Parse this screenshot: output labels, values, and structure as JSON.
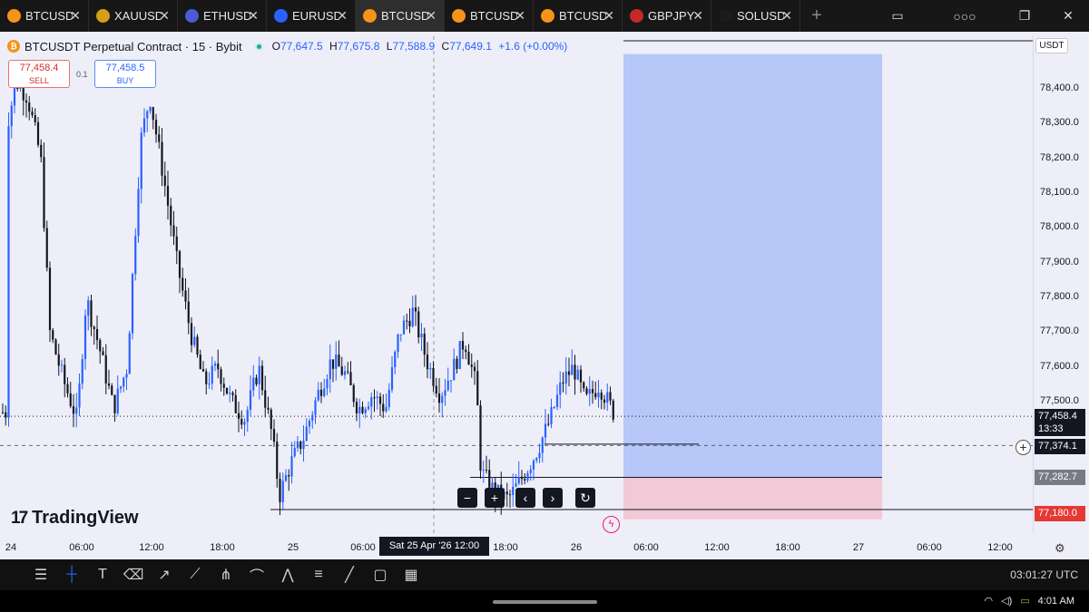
{
  "tabs": [
    {
      "label": "BTCUSD",
      "icon": "bitcoin-icon",
      "color": "#f7931a",
      "active": false
    },
    {
      "label": "XAUUSD",
      "icon": "gold-bars-icon",
      "color": "#d4a017",
      "active": false
    },
    {
      "label": "ETHUSD",
      "icon": "ethereum-icon",
      "color": "#4a5bd4",
      "active": false
    },
    {
      "label": "EURUSD",
      "icon": "euro-flag-icon",
      "color": "#2962ff",
      "active": false
    },
    {
      "label": "BTCUSD",
      "icon": "bitcoin-icon",
      "color": "#f7931a",
      "active": true
    },
    {
      "label": "BTCUSD",
      "icon": "bitcoin-icon",
      "color": "#f7931a",
      "active": false
    },
    {
      "label": "BTCUSD",
      "icon": "bitcoin-icon",
      "color": "#f7931a",
      "active": false
    },
    {
      "label": "GBPJPY",
      "icon": "uk-flag-icon",
      "color": "#c62828",
      "active": false
    },
    {
      "label": "SOLUSD",
      "icon": "solana-icon",
      "color": "#1b1b1b",
      "active": false
    }
  ],
  "header": {
    "title": "BTCUSDT Perpetual Contract · 15 · Bybit",
    "o_label": "O",
    "o_value": "77,647.5",
    "h_label": "H",
    "h_value": "77,675.8",
    "l_label": "L",
    "l_value": "77,588.9",
    "c_label": "C",
    "c_value": "77,649.1",
    "change": "+1.6 (+0.00%)"
  },
  "trade": {
    "sell_price": "77,458.4",
    "sell_label": "SELL",
    "spread": "0.1",
    "buy_price": "77,458.5",
    "buy_label": "BUY"
  },
  "price_axis": {
    "currency": "USDT",
    "ticks": [
      "78,400.0",
      "78,300.0",
      "78,200.0",
      "78,100.0",
      "78,000.0",
      "77,900.0",
      "77,800.0",
      "77,700.0",
      "77,600.0",
      "77,500.0"
    ],
    "last_price": "77,458.4",
    "countdown": "13:33",
    "crosshair_price": "77,374.1",
    "entry_price": "77,282.7",
    "stop_price": "77,180.0"
  },
  "time_axis": {
    "ticks": [
      "24",
      "06:00",
      "12:00",
      "18:00",
      "25",
      "06:00",
      "18:00",
      "26",
      "06:00",
      "12:00",
      "18:00",
      "27",
      "06:00",
      "12:00"
    ],
    "cursor_label": "Sat 25 Apr '26   12:00"
  },
  "chart_data": {
    "type": "candlestick",
    "symbol": "BTCUSDT",
    "timeframe": "15",
    "ylim": [
      77150,
      78450
    ],
    "position": {
      "type": "long",
      "entry": 77282.7,
      "stop": 77180.0
    },
    "last_price": 77458.4
  },
  "colors": {
    "up": "#2962ff",
    "down": "#131722",
    "profit_zone": "#b6c7f8",
    "loss_zone": "#f2c9d6",
    "sell": "#d32f2f",
    "buy": "#2962ff",
    "stop_label": "#e53935",
    "entry_label": "#787b86"
  },
  "branding": {
    "logo": "TradingView"
  },
  "status": {
    "utc_clock": "03:01:27 UTC",
    "device_time": "4:01 AM"
  },
  "toolbar": [
    "settings-sliders-icon",
    "crosshair-icon",
    "text-icon",
    "eraser-icon",
    "arrow-icon",
    "trend-line-icon",
    "pitchfork-icon",
    "path-icon",
    "zigzag-icon",
    "fib-icon",
    "ray-icon",
    "rectangle-icon",
    "grid-icon"
  ]
}
